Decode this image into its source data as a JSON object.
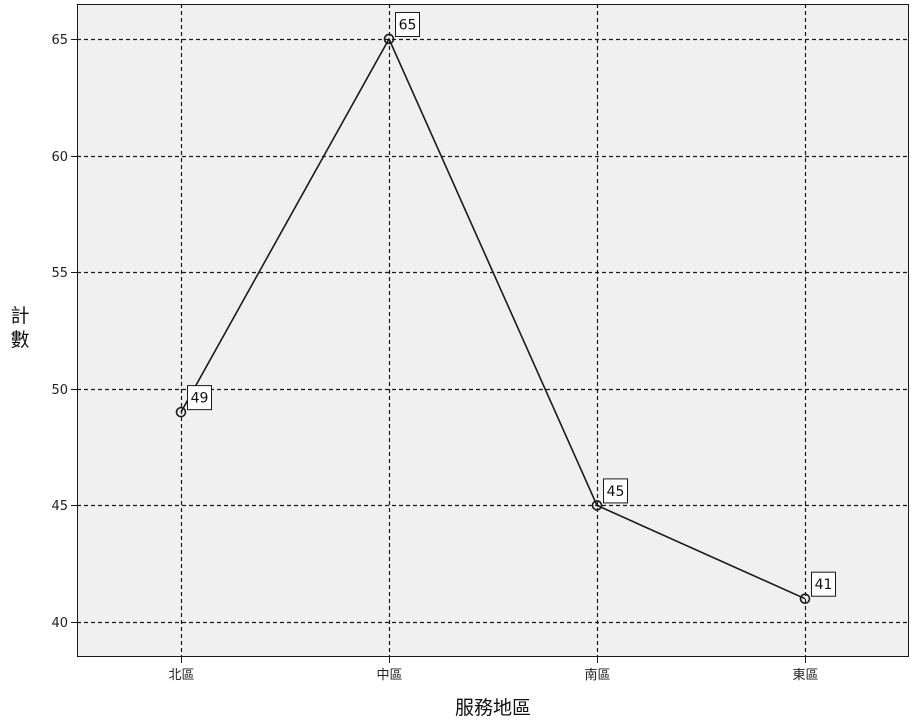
{
  "chart_data": {
    "type": "line",
    "categories": [
      "北區",
      "中區",
      "南區",
      "東區"
    ],
    "values": [
      49,
      65,
      45,
      41
    ],
    "data_labels": [
      "49",
      "65",
      "45",
      "41"
    ],
    "xlabel": "服務地區",
    "ylabel": "計數",
    "ylabel_chars": [
      "計",
      "數"
    ],
    "yticks": [
      40,
      45,
      50,
      55,
      60,
      65
    ],
    "ytick_labels": [
      "40",
      "45",
      "50",
      "55",
      "60",
      "65"
    ],
    "ylim": [
      38.5,
      66.5
    ],
    "grid": true,
    "markers": "open-circle",
    "colors": {
      "line": "#1a1a1a",
      "plot_background": "#f0f0f0",
      "grid": "#1a1a1a",
      "frame": "#1a1a1a"
    }
  }
}
